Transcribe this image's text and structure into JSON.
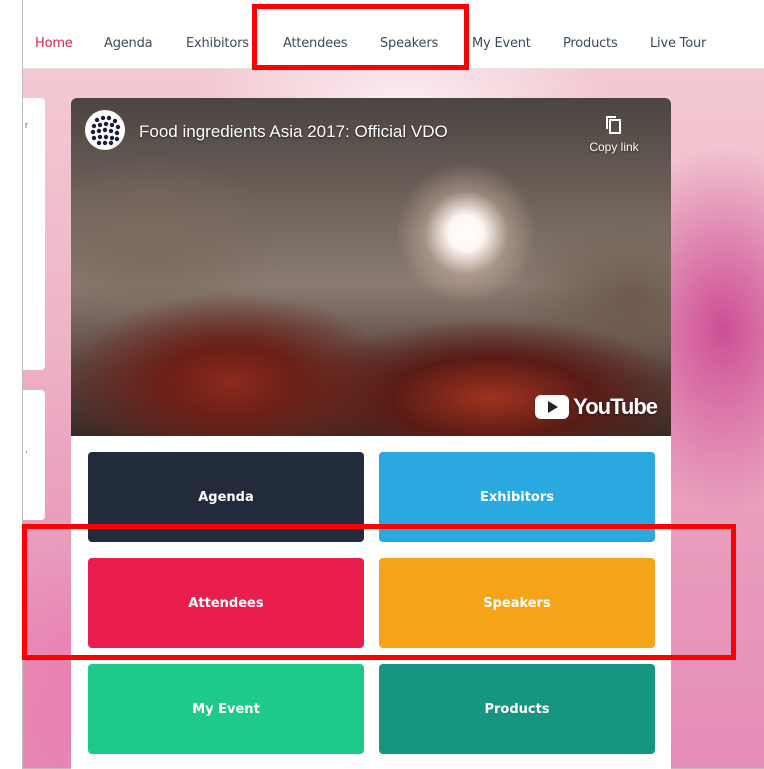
{
  "nav": {
    "items": [
      {
        "label": "Home",
        "active": true
      },
      {
        "label": "Agenda"
      },
      {
        "label": "Exhibitors"
      },
      {
        "label": "Attendees"
      },
      {
        "label": "Speakers"
      },
      {
        "label": "My Event"
      },
      {
        "label": "Products"
      },
      {
        "label": "Live Tour"
      }
    ]
  },
  "video": {
    "title": "Food ingredients Asia 2017: Official VDO",
    "copy_link_label": "Copy link",
    "platform": "YouTube"
  },
  "tiles": [
    {
      "label": "Agenda",
      "color": "#222b3c"
    },
    {
      "label": "Exhibitors",
      "color": "#2aa8e0"
    },
    {
      "label": "Attendees",
      "color": "#e91e4d"
    },
    {
      "label": "Speakers",
      "color": "#f5a418"
    },
    {
      "label": "My Event",
      "color": "#1ec98a"
    },
    {
      "label": "Products",
      "color": "#169681"
    }
  ],
  "colors": {
    "nav_active": "#e01f4b",
    "nav_text": "#3e4a5b",
    "annotation": "#ff0000"
  }
}
